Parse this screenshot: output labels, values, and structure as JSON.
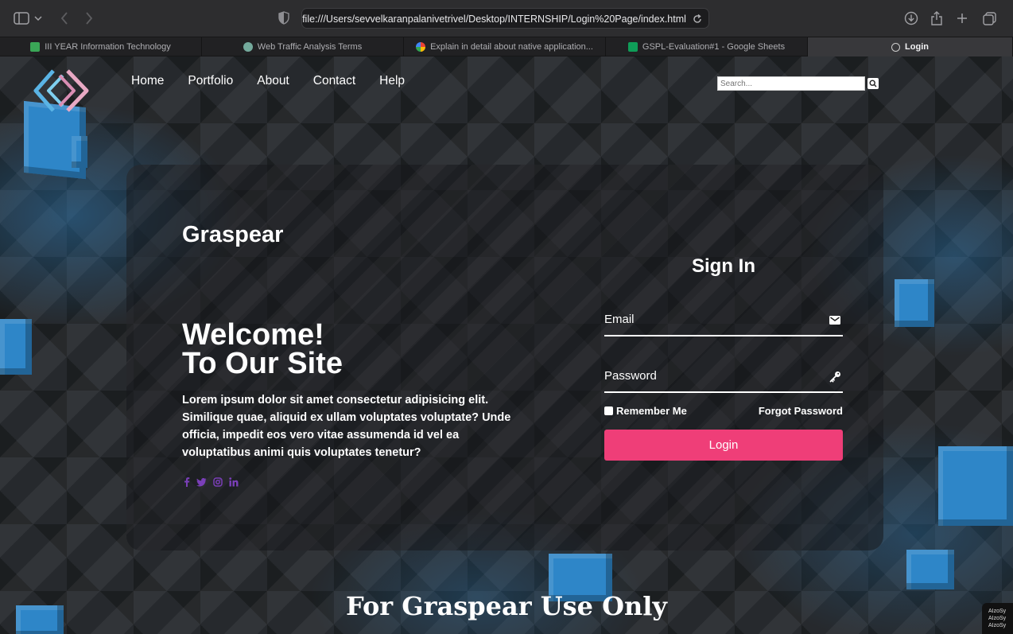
{
  "browser": {
    "url": "file:///Users/sevvelkaranpalanivetrivel/Desktop/INTERNSHIP/Login%20Page/index.html",
    "tabs": [
      {
        "label": "III YEAR Information Technology",
        "icon": "sheets-icon",
        "color": "#3aa757"
      },
      {
        "label": "Web Traffic Analysis Terms",
        "icon": "chatgpt-icon",
        "color": "#74aa9c"
      },
      {
        "label": "Explain in detail about native application...",
        "icon": "google-icon",
        "color": "#ea4335"
      },
      {
        "label": "GSPL-Evaluation#1 - Google Sheets",
        "icon": "sheets-icon",
        "color": "#0f9d58"
      },
      {
        "label": "Login",
        "icon": "compass-icon",
        "color": "#cccccc"
      }
    ]
  },
  "nav": {
    "items": [
      "Home",
      "Portfolio",
      "About",
      "Contact",
      "Help"
    ],
    "search_placeholder": "Search..."
  },
  "hero": {
    "brand": "Graspear",
    "welcome_line1": "Welcome!",
    "welcome_line2": "To Our Site",
    "description": "Lorem ipsum dolor sit amet consectetur adipisicing elit. Similique quae, aliquid ex ullam voluptates voluptate? Unde officia, impedit eos vero vitae assumenda id vel ea voluptatibus animi quis voluptates tenetur?",
    "socials": [
      "facebook-icon",
      "twitter-icon",
      "instagram-icon",
      "linkedin-icon"
    ]
  },
  "signin": {
    "title": "Sign In",
    "email_label": "Email",
    "password_label": "Password",
    "remember_label": "Remember Me",
    "forgot_label": "Forgot Password",
    "login_label": "Login"
  },
  "footer": {
    "title": "For Graspear Use Only",
    "corner_text": "AIzoSy AIzoSy AIzoSy"
  },
  "colors": {
    "accent": "#ef3e78",
    "cube_blue": "#2e86c8",
    "social": "#7a3fb8"
  }
}
